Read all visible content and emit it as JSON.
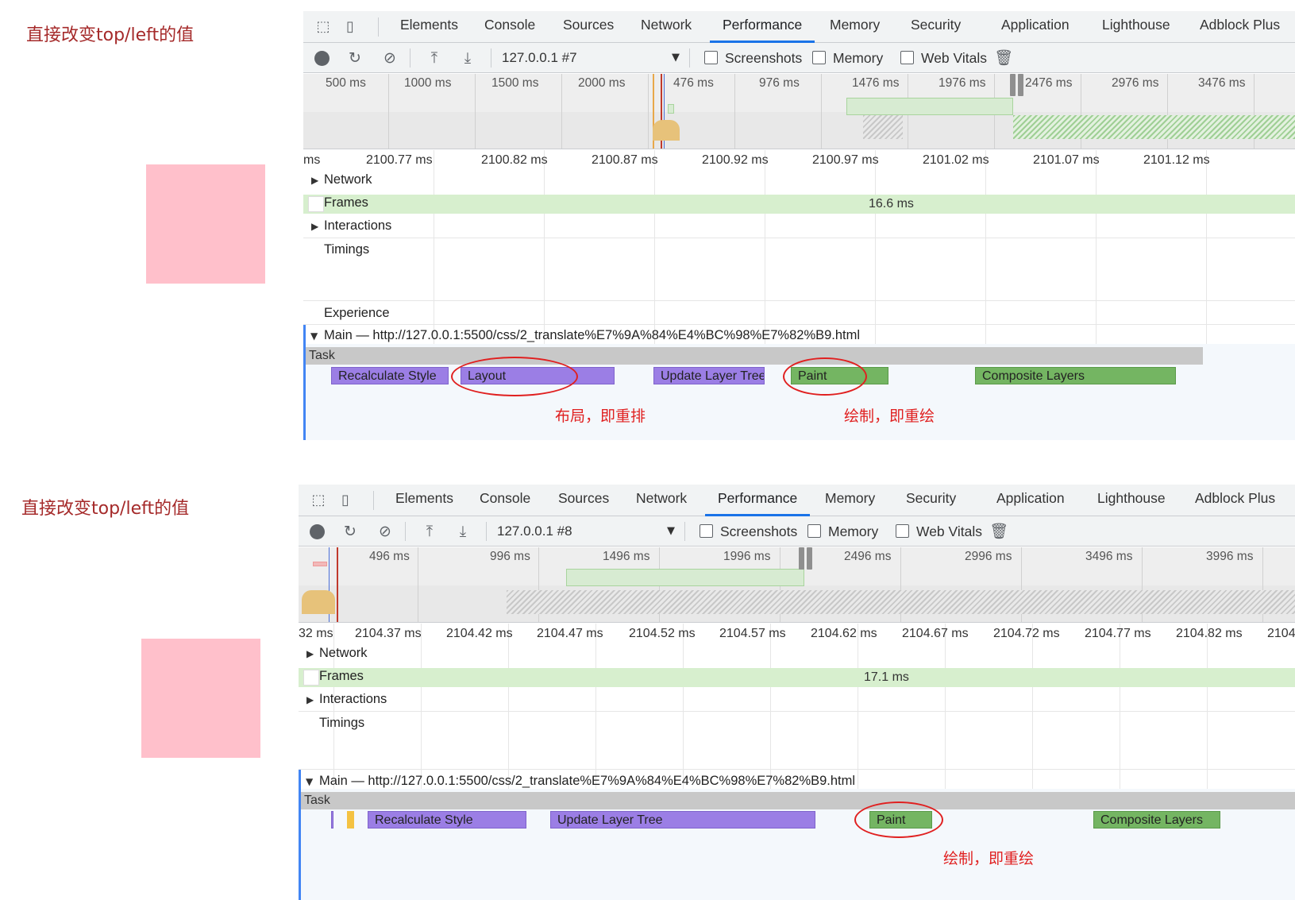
{
  "panels": [
    {
      "heading": "直接改变top/left的值",
      "devtools": {
        "tabs": [
          "Elements",
          "Console",
          "Sources",
          "Network",
          "Performance",
          "Memory",
          "Security",
          "Application",
          "Lighthouse",
          "Adblock Plus"
        ],
        "active_tab": "Performance",
        "profile": "127.0.0.1 #7",
        "checkboxes": [
          {
            "label": "Screenshots",
            "checked": false
          },
          {
            "label": "Memory",
            "checked": false
          },
          {
            "label": "Web Vitals",
            "checked": false
          }
        ],
        "overview_ticks": [
          "500 ms",
          "1000 ms",
          "1500 ms",
          "2000 ms",
          "476 ms",
          "976 ms",
          "1476 ms",
          "1976 ms",
          "2476 ms",
          "2976 ms",
          "3476 ms"
        ],
        "ruler": [
          "ms",
          "2100.77 ms",
          "2100.82 ms",
          "2100.87 ms",
          "2100.92 ms",
          "2100.97 ms",
          "2101.02 ms",
          "2101.07 ms",
          "2101.12 ms"
        ],
        "tracks": {
          "network": "Network",
          "frames": "Frames",
          "frame_duration": "16.6 ms",
          "interactions": "Interactions",
          "timings": "Timings",
          "experience": "Experience",
          "main": "Main — http://127.0.0.1:5500/css/2_translate%E7%9A%84%E4%BC%98%E7%82%B9.html",
          "task": "Task"
        },
        "events": [
          "Recalculate Style",
          "Layout",
          "Update Layer Tree",
          "Paint",
          "Composite Layers"
        ],
        "annotations": [
          "布局，即重排",
          "绘制，即重绘"
        ]
      }
    },
    {
      "heading": "直接改变top/left的值",
      "devtools": {
        "tabs": [
          "Elements",
          "Console",
          "Sources",
          "Network",
          "Performance",
          "Memory",
          "Security",
          "Application",
          "Lighthouse",
          "Adblock Plus"
        ],
        "active_tab": "Performance",
        "profile": "127.0.0.1 #8",
        "checkboxes": [
          {
            "label": "Screenshots",
            "checked": false
          },
          {
            "label": "Memory",
            "checked": false
          },
          {
            "label": "Web Vitals",
            "checked": false
          }
        ],
        "overview_ticks": [
          "496 ms",
          "996 ms",
          "1496 ms",
          "1996 ms",
          "2496 ms",
          "2996 ms",
          "3496 ms",
          "3996 ms"
        ],
        "ruler": [
          "32 ms",
          "2104.37 ms",
          "2104.42 ms",
          "2104.47 ms",
          "2104.52 ms",
          "2104.57 ms",
          "2104.62 ms",
          "2104.67 ms",
          "2104.72 ms",
          "2104.77 ms",
          "2104.82 ms",
          "2104"
        ],
        "tracks": {
          "network": "Network",
          "frames": "Frames",
          "frame_duration": "17.1 ms",
          "interactions": "Interactions",
          "timings": "Timings",
          "main": "Main — http://127.0.0.1:5500/css/2_translate%E7%9A%84%E4%BC%98%E7%82%B9.html",
          "task": "Task"
        },
        "events": [
          "Recalculate Style",
          "Update Layer Tree",
          "Paint",
          "Composite Layers"
        ],
        "annotations": [
          "绘制，即重绘"
        ]
      }
    }
  ],
  "colors": {
    "heading": "#a52a2a",
    "pink_box": "#ffc0cb",
    "annotation": "#e02020",
    "event_purple": "#9b7ee5",
    "event_green": "#74b562",
    "frames": "#d7efce",
    "active_tab": "#1a73e8"
  },
  "icons": [
    "select-element-icon",
    "device-toolbar-icon",
    "record-icon",
    "reload-icon",
    "clear-icon",
    "upload-icon",
    "download-icon",
    "dropdown-arrow-icon",
    "trash-icon",
    "expand-triangle-icon"
  ]
}
